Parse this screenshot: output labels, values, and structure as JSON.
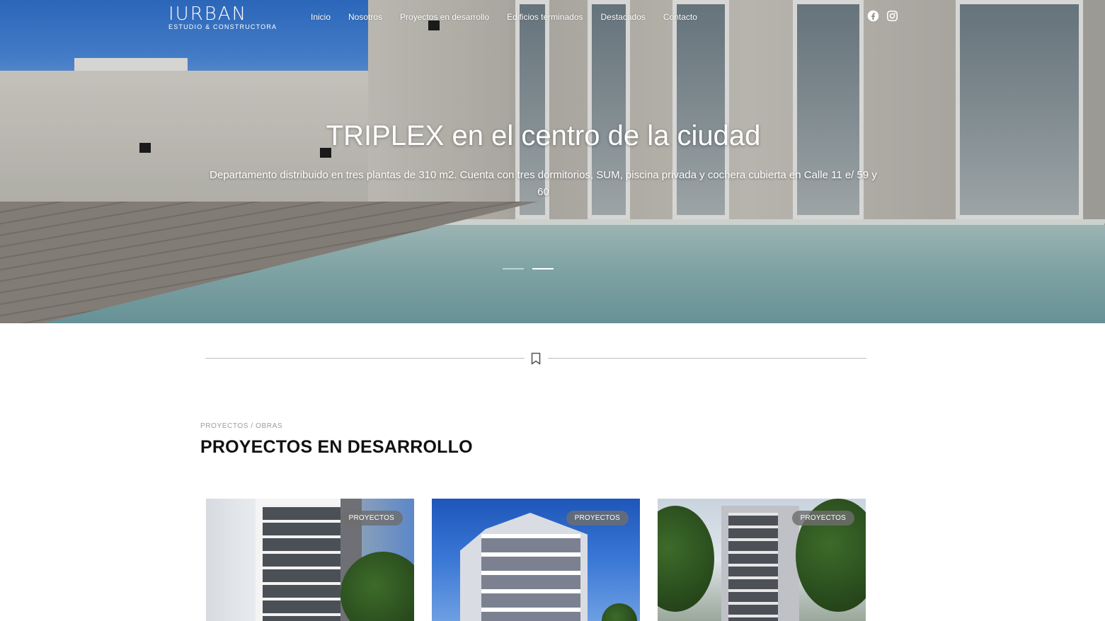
{
  "brand": {
    "name": "IURBAN",
    "tagline": "ESTUDIO & CONSTRUCTORA"
  },
  "nav": [
    {
      "label": "Inicio"
    },
    {
      "label": "Nosotros"
    },
    {
      "label": "Proyectos en desarrollo"
    },
    {
      "label": "Edificios terminados"
    },
    {
      "label": "Destacados"
    },
    {
      "label": "Contacto"
    }
  ],
  "social": [
    {
      "icon": "facebook-icon"
    },
    {
      "icon": "instagram-icon"
    }
  ],
  "hero": {
    "title": "TRIPLEX en el centro de la ciudad",
    "description": "Departamento distribuido en tres plantas de 310 m2. Cuenta con tres dormitorios, SUM, piscina privada y cochera cubierta en Calle 11 e/ 59 y 60",
    "slides": 2,
    "active_slide": 2
  },
  "section": {
    "eyebrow": "PROYECTOS / OBRAS",
    "title": "PROYECTOS EN DESARROLLO"
  },
  "cards": [
    {
      "tag": "PROYECTOS"
    },
    {
      "tag": "PROYECTOS"
    },
    {
      "tag": "PROYECTOS"
    }
  ],
  "colors": {
    "accent": "#ffffff",
    "text": "#111111",
    "muted": "#9c9c9c",
    "tag_bg": "#6e6e6e"
  }
}
